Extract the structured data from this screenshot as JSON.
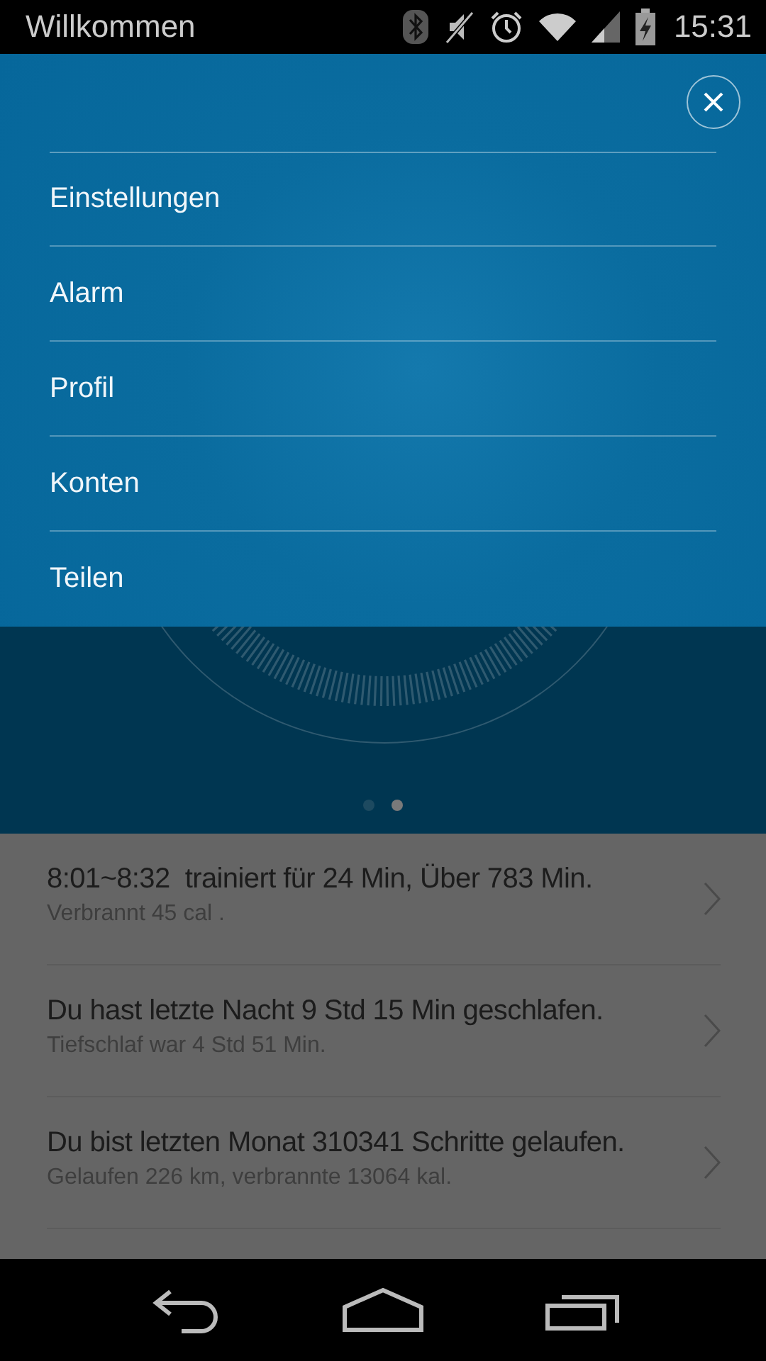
{
  "status_bar": {
    "title": "Willkommen",
    "time": "15:31"
  },
  "menu": {
    "items": [
      {
        "label": "Einstellungen"
      },
      {
        "label": "Alarm"
      },
      {
        "label": "Profil"
      },
      {
        "label": "Konten"
      },
      {
        "label": "Teilen"
      }
    ]
  },
  "pager": {
    "pages": [
      {
        "selected": false
      },
      {
        "selected": true
      }
    ]
  },
  "feed": {
    "rows": [
      {
        "title": "8:01~8:32  trainiert für 24 Min, Über 783 Min.",
        "subtitle": "Verbrannt 45 cal ."
      },
      {
        "title": "Du hast letzte Nacht 9 Std 15 Min geschlafen.",
        "subtitle": "Tiefschlaf war 4 Std 51 Min."
      },
      {
        "title": "Du bist letzten Monat 310341 Schritte gelaufen.",
        "subtitle": "Gelaufen 226 km, verbrannte 13064 kal."
      }
    ]
  }
}
